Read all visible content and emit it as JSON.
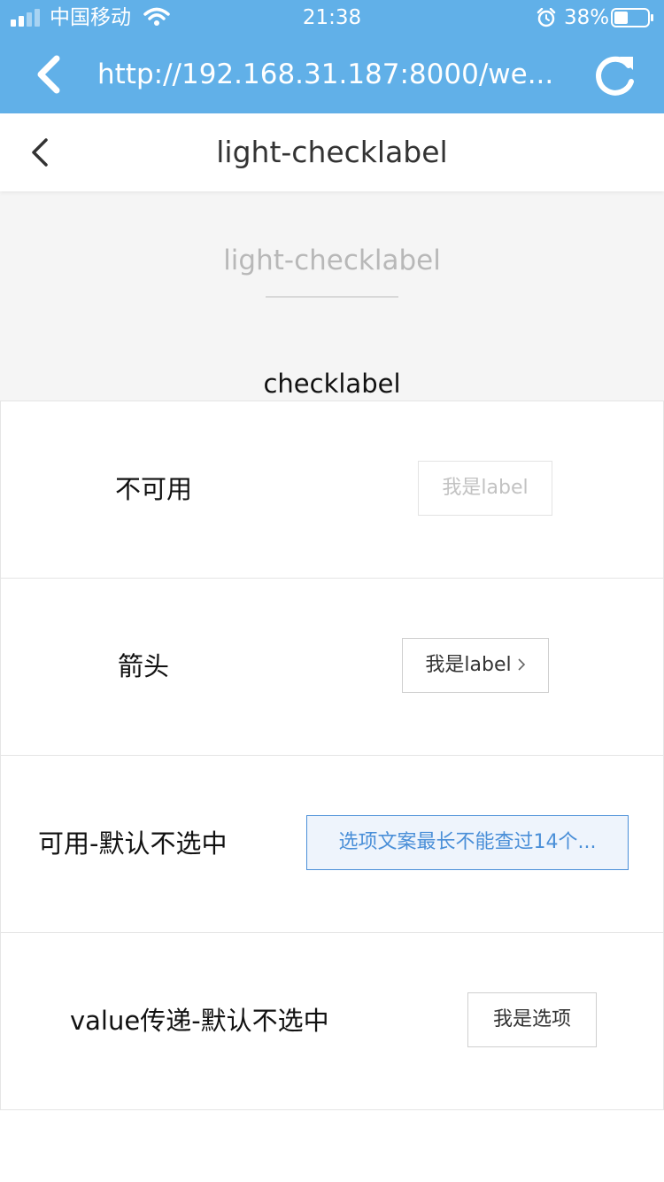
{
  "status_bar": {
    "carrier": "中国移动",
    "time": "21:38",
    "battery": "38%"
  },
  "browser": {
    "url": "http://192.168.31.187:8000/we..."
  },
  "navbar": {
    "title": "light-checklabel"
  },
  "page": {
    "heading": "light-checklabel",
    "section_title": "checklabel"
  },
  "rows": [
    {
      "label": "不可用",
      "chip": "我是label"
    },
    {
      "label": "箭头",
      "chip": "我是label"
    },
    {
      "label": "可用-默认不选中",
      "chip": "选项文案最长不能查过14个..."
    },
    {
      "label": "value传递-默认不选中",
      "chip": "我是选项"
    }
  ],
  "colors": {
    "accent": "#61b0e8",
    "selected": "#4a8fd8",
    "page_bg": "#f5f5f5"
  }
}
